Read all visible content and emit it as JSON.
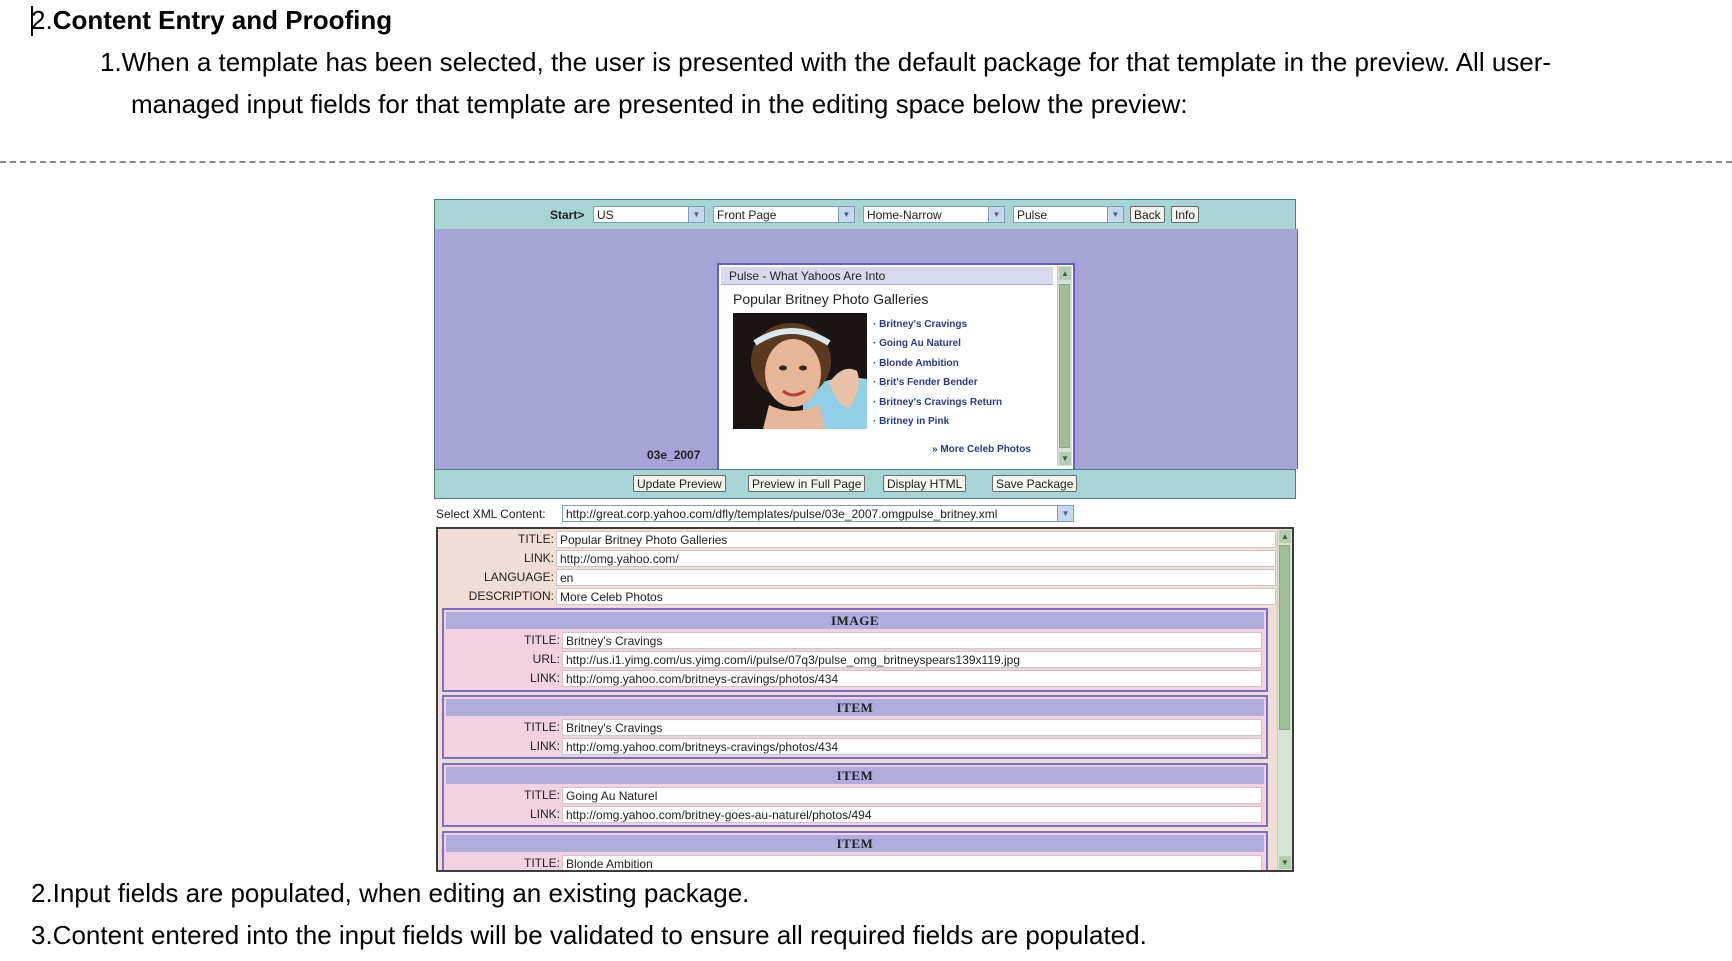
{
  "document": {
    "heading_number": "2.",
    "heading_text": "Content Entry and Proofing",
    "para1_line1": "1.When a template has been selected, the user is presented with the default package for that template in the preview. All user-",
    "para1_line2": "managed input fields for that template are presented in the editing space below the preview:",
    "para2": "2.Input fields are populated, when editing an existing package.",
    "para3": "3.Content entered into the input fields will be validated to ensure all required fields are populated."
  },
  "toolbar": {
    "start_label": "Start>",
    "selects": [
      "US",
      "Front Page",
      "Home-Narrow",
      "Pulse"
    ],
    "back": "Back",
    "info": "Info"
  },
  "preview": {
    "header": "Pulse - What Yahoos Are Into",
    "title": "Popular Britney Photo Galleries",
    "links": [
      "Britney's Cravings",
      "Going Au Naturel",
      "Blonde Ambition",
      "Brit's Fender Bender",
      "Britney's Cravings Return",
      "Britney in Pink"
    ],
    "more": "» More Celeb Photos",
    "stamp": "03e_2007"
  },
  "buttons": {
    "update": "Update Preview",
    "full": "Preview in Full Page",
    "html": "Display HTML",
    "save": "Save Package"
  },
  "xml": {
    "label": "Select XML Content:",
    "value": "http://great.corp.yahoo.com/dfly/templates/pulse/03e_2007.omgpulse_britney.xml"
  },
  "channel": {
    "title_label": "TITLE:",
    "title": "Popular Britney Photo Galleries",
    "link_label": "LINK:",
    "link": "http://omg.yahoo.com/",
    "language_label": "LANGUAGE:",
    "language": "en",
    "description_label": "DESCRIPTION:",
    "description": "More Celeb Photos"
  },
  "sections": [
    {
      "head": "IMAGE",
      "title": "Britney's Cravings",
      "url": "http://us.i1.yimg.com/us.yimg.com/i/pulse/07q3/pulse_omg_britneyspears139x119.jpg",
      "link": "http://omg.yahoo.com/britneys-cravings/photos/434"
    },
    {
      "head": "ITEM",
      "title": "Britney's Cravings",
      "link": "http://omg.yahoo.com/britneys-cravings/photos/434"
    },
    {
      "head": "ITEM",
      "title": "Going Au Naturel",
      "link": "http://omg.yahoo.com/britney-goes-au-naturel/photos/494"
    },
    {
      "head": "ITEM",
      "title": "Blonde Ambition"
    }
  ],
  "field_labels": {
    "title": "TITLE:",
    "url": "URL:",
    "link": "LINK:"
  }
}
